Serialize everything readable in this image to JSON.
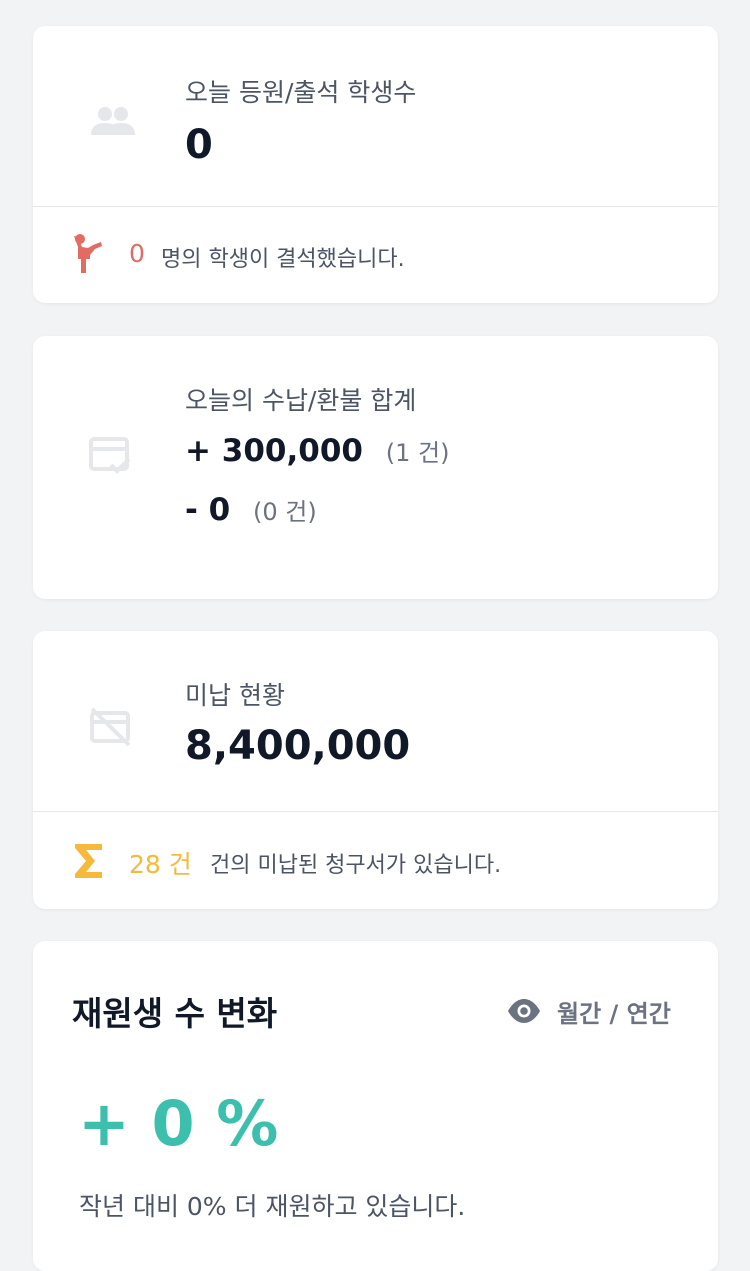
{
  "attendance": {
    "label": "오늘 등원/출석 학생수",
    "value": "0",
    "absent_count": "0",
    "absent_text": "명의 학생이 결석했습니다."
  },
  "payments": {
    "label": "오늘의 수납/환불 합계",
    "income_amount": "+ 300,000",
    "income_count": "(1 건)",
    "refund_amount": "- 0",
    "refund_count": "(0 건)"
  },
  "unpaid": {
    "label": "미납 현황",
    "value": "8,400,000",
    "bill_count": "28 건",
    "bill_text": "건의 미납된 청구서가 있습니다."
  },
  "enrollment_change": {
    "title": "재원생 수 변화",
    "toggle_label": "월간 / 연간",
    "change_value": "+ 0 %",
    "description": "작년 대비 0% 더 재원하고 있습니다."
  },
  "colors": {
    "absent_accent": "#e06c63",
    "unpaid_accent": "#f6b93b",
    "growth_accent": "#3dbfae",
    "muted_icon": "#e5e7eb"
  },
  "icons": {
    "attendance": "people-icon",
    "absent": "person-waving-icon",
    "payments": "card-check-icon",
    "unpaid": "card-off-icon",
    "bills": "sigma-icon",
    "toggle": "eye-icon"
  }
}
